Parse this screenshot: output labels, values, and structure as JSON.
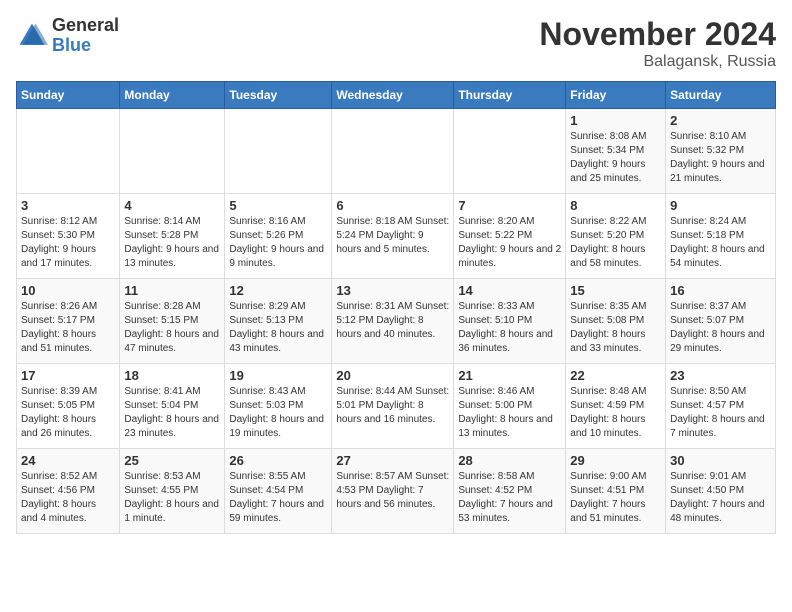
{
  "logo": {
    "general": "General",
    "blue": "Blue"
  },
  "title": "November 2024",
  "location": "Balagansk, Russia",
  "days_of_week": [
    "Sunday",
    "Monday",
    "Tuesday",
    "Wednesday",
    "Thursday",
    "Friday",
    "Saturday"
  ],
  "weeks": [
    [
      {
        "day": "",
        "info": ""
      },
      {
        "day": "",
        "info": ""
      },
      {
        "day": "",
        "info": ""
      },
      {
        "day": "",
        "info": ""
      },
      {
        "day": "",
        "info": ""
      },
      {
        "day": "1",
        "info": "Sunrise: 8:08 AM\nSunset: 5:34 PM\nDaylight: 9 hours and 25 minutes."
      },
      {
        "day": "2",
        "info": "Sunrise: 8:10 AM\nSunset: 5:32 PM\nDaylight: 9 hours and 21 minutes."
      }
    ],
    [
      {
        "day": "3",
        "info": "Sunrise: 8:12 AM\nSunset: 5:30 PM\nDaylight: 9 hours and 17 minutes."
      },
      {
        "day": "4",
        "info": "Sunrise: 8:14 AM\nSunset: 5:28 PM\nDaylight: 9 hours and 13 minutes."
      },
      {
        "day": "5",
        "info": "Sunrise: 8:16 AM\nSunset: 5:26 PM\nDaylight: 9 hours and 9 minutes."
      },
      {
        "day": "6",
        "info": "Sunrise: 8:18 AM\nSunset: 5:24 PM\nDaylight: 9 hours and 5 minutes."
      },
      {
        "day": "7",
        "info": "Sunrise: 8:20 AM\nSunset: 5:22 PM\nDaylight: 9 hours and 2 minutes."
      },
      {
        "day": "8",
        "info": "Sunrise: 8:22 AM\nSunset: 5:20 PM\nDaylight: 8 hours and 58 minutes."
      },
      {
        "day": "9",
        "info": "Sunrise: 8:24 AM\nSunset: 5:18 PM\nDaylight: 8 hours and 54 minutes."
      }
    ],
    [
      {
        "day": "10",
        "info": "Sunrise: 8:26 AM\nSunset: 5:17 PM\nDaylight: 8 hours and 51 minutes."
      },
      {
        "day": "11",
        "info": "Sunrise: 8:28 AM\nSunset: 5:15 PM\nDaylight: 8 hours and 47 minutes."
      },
      {
        "day": "12",
        "info": "Sunrise: 8:29 AM\nSunset: 5:13 PM\nDaylight: 8 hours and 43 minutes."
      },
      {
        "day": "13",
        "info": "Sunrise: 8:31 AM\nSunset: 5:12 PM\nDaylight: 8 hours and 40 minutes."
      },
      {
        "day": "14",
        "info": "Sunrise: 8:33 AM\nSunset: 5:10 PM\nDaylight: 8 hours and 36 minutes."
      },
      {
        "day": "15",
        "info": "Sunrise: 8:35 AM\nSunset: 5:08 PM\nDaylight: 8 hours and 33 minutes."
      },
      {
        "day": "16",
        "info": "Sunrise: 8:37 AM\nSunset: 5:07 PM\nDaylight: 8 hours and 29 minutes."
      }
    ],
    [
      {
        "day": "17",
        "info": "Sunrise: 8:39 AM\nSunset: 5:05 PM\nDaylight: 8 hours and 26 minutes."
      },
      {
        "day": "18",
        "info": "Sunrise: 8:41 AM\nSunset: 5:04 PM\nDaylight: 8 hours and 23 minutes."
      },
      {
        "day": "19",
        "info": "Sunrise: 8:43 AM\nSunset: 5:03 PM\nDaylight: 8 hours and 19 minutes."
      },
      {
        "day": "20",
        "info": "Sunrise: 8:44 AM\nSunset: 5:01 PM\nDaylight: 8 hours and 16 minutes."
      },
      {
        "day": "21",
        "info": "Sunrise: 8:46 AM\nSunset: 5:00 PM\nDaylight: 8 hours and 13 minutes."
      },
      {
        "day": "22",
        "info": "Sunrise: 8:48 AM\nSunset: 4:59 PM\nDaylight: 8 hours and 10 minutes."
      },
      {
        "day": "23",
        "info": "Sunrise: 8:50 AM\nSunset: 4:57 PM\nDaylight: 8 hours and 7 minutes."
      }
    ],
    [
      {
        "day": "24",
        "info": "Sunrise: 8:52 AM\nSunset: 4:56 PM\nDaylight: 8 hours and 4 minutes."
      },
      {
        "day": "25",
        "info": "Sunrise: 8:53 AM\nSunset: 4:55 PM\nDaylight: 8 hours and 1 minute."
      },
      {
        "day": "26",
        "info": "Sunrise: 8:55 AM\nSunset: 4:54 PM\nDaylight: 7 hours and 59 minutes."
      },
      {
        "day": "27",
        "info": "Sunrise: 8:57 AM\nSunset: 4:53 PM\nDaylight: 7 hours and 56 minutes."
      },
      {
        "day": "28",
        "info": "Sunrise: 8:58 AM\nSunset: 4:52 PM\nDaylight: 7 hours and 53 minutes."
      },
      {
        "day": "29",
        "info": "Sunrise: 9:00 AM\nSunset: 4:51 PM\nDaylight: 7 hours and 51 minutes."
      },
      {
        "day": "30",
        "info": "Sunrise: 9:01 AM\nSunset: 4:50 PM\nDaylight: 7 hours and 48 minutes."
      }
    ]
  ]
}
